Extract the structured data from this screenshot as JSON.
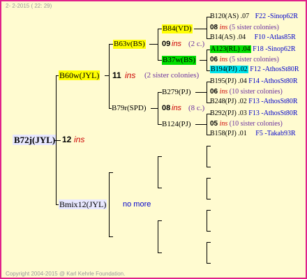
{
  "header": {
    "date_text": "2-  2-2015 ( 22: 29)"
  },
  "footer": {
    "copyright": "Copyright 2004-2015 @ Karl Kehrle Foundation."
  },
  "colors": {
    "yellow": "#ffff00",
    "green": "#00dd00",
    "cyan": "#00e5ee",
    "lavender": "#e8e8ff",
    "border": "#e0218a",
    "background": "#fffbd0"
  },
  "root": {
    "name": "B72j(JYL)",
    "ins_count": "12",
    "ins_label": "ins"
  },
  "father": {
    "name": "B60w(JYL)",
    "ins_count": "11",
    "ins_label": "ins",
    "siblings_note": "(2 sister colonies)"
  },
  "mother_side": {
    "name": "Bmix12(JYL)",
    "note": "no more"
  },
  "gf1": {
    "name": "B63v(BS)"
  },
  "gf2": {
    "name": "B79r(SPD)"
  },
  "gg1": {
    "name": "B84(VD)",
    "ins_count": "09",
    "ins_label": "ins",
    "note": "(2 c.)"
  },
  "gg2": {
    "name": "B37w(BS)"
  },
  "gg3": {
    "name": "B279(PJ)",
    "ins_count": "08",
    "ins_label": "ins",
    "note": "(8 c.)"
  },
  "gg4": {
    "name": "B124(PJ)"
  },
  "leaves": [
    {
      "name": "B120(AS)",
      "num": ".07",
      "code": "F22 -Sinop62R"
    },
    {
      "count": "08",
      "ins": "ins",
      "note": "(5 sister colonies)"
    },
    {
      "name": "B14(AS)",
      "num": ".04",
      "code": "F10 -Atlas85R"
    },
    {
      "name": "A123(RL)",
      "num": ".04",
      "code": "F18 -Sinop62R"
    },
    {
      "count": "06",
      "ins": "ins",
      "note": "(5 sister colonies)"
    },
    {
      "name": "B194(PJ)",
      "num": ".02",
      "code": "F12 -AthosSt80R"
    },
    {
      "name": "B195(PJ)",
      "num": ".04",
      "code": "F14 -AthosSt80R"
    },
    {
      "count": "06",
      "ins": "ins",
      "note": "(10 sister colonies)"
    },
    {
      "name": "B248(PJ)",
      "num": ".02",
      "code": "F13 -AthosSt80R"
    },
    {
      "name": "B292(PJ)",
      "num": ".03",
      "code": "F13 -AthosSt80R"
    },
    {
      "count": "05",
      "ins": "ins",
      "note": "(10 sister colonies)"
    },
    {
      "name": "B158(PJ)",
      "num": ".01",
      "code": "F5 -Takab93R"
    }
  ]
}
